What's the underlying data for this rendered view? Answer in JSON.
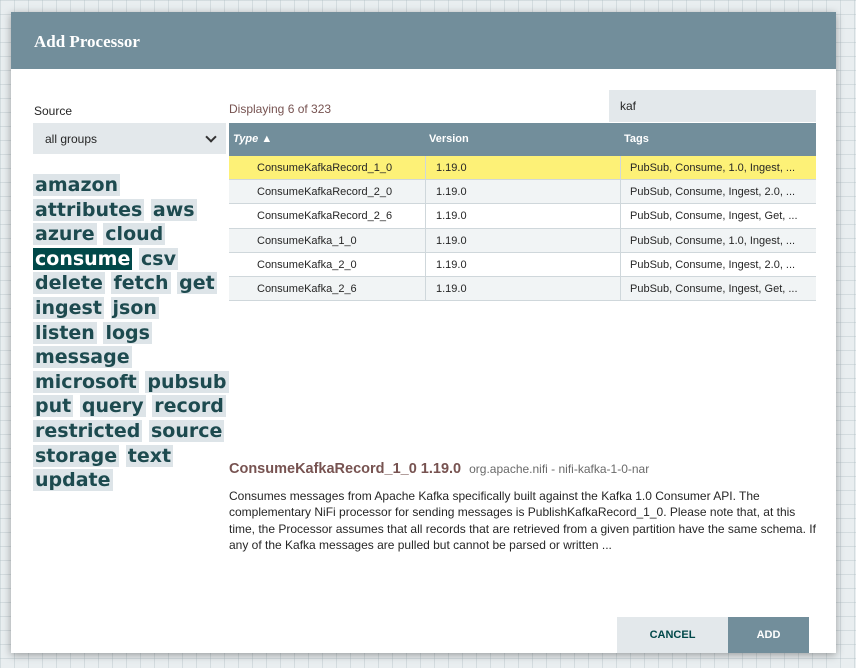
{
  "dialog": {
    "title": "Add Processor"
  },
  "source": {
    "label": "Source",
    "selected": "all groups"
  },
  "tags": [
    "amazon",
    "attributes",
    "aws",
    "azure",
    "cloud",
    "consume",
    "csv",
    "delete",
    "fetch",
    "get",
    "ingest",
    "json",
    "listen",
    "logs",
    "message",
    "microsoft",
    "pubsub",
    "put",
    "query",
    "record",
    "restricted",
    "source",
    "storage",
    "text",
    "update"
  ],
  "selected_tag": "consume",
  "table": {
    "displaying": "Displaying 6 of 323",
    "filter_value": "kaf",
    "headers": {
      "type": "Type ▲",
      "version": "Version",
      "tags": "Tags"
    },
    "rows": [
      {
        "type": "ConsumeKafkaRecord_1_0",
        "version": "1.19.0",
        "tags": "PubSub, Consume, 1.0, Ingest, ..."
      },
      {
        "type": "ConsumeKafkaRecord_2_0",
        "version": "1.19.0",
        "tags": "PubSub, Consume, Ingest, 2.0, ..."
      },
      {
        "type": "ConsumeKafkaRecord_2_6",
        "version": "1.19.0",
        "tags": "PubSub, Consume, Ingest, Get, ..."
      },
      {
        "type": "ConsumeKafka_1_0",
        "version": "1.19.0",
        "tags": "PubSub, Consume, 1.0, Ingest, ..."
      },
      {
        "type": "ConsumeKafka_2_0",
        "version": "1.19.0",
        "tags": "PubSub, Consume, Ingest, 2.0, ..."
      },
      {
        "type": "ConsumeKafka_2_6",
        "version": "1.19.0",
        "tags": "PubSub, Consume, Ingest, Get, ..."
      }
    ],
    "selected_index": 0
  },
  "details": {
    "name": "ConsumeKafkaRecord_1_0 1.19.0",
    "bundle": "org.apache.nifi - nifi-kafka-1-0-nar",
    "description": "Consumes messages from Apache Kafka specifically built against the Kafka 1.0 Consumer API. The complementary NiFi processor for sending messages is PublishKafkaRecord_1_0. Please note that, at this time, the Processor assumes that all records that are retrieved from a given partition have the same schema. If any of the Kafka messages are pulled but cannot be parsed or written ..."
  },
  "buttons": {
    "cancel": "CANCEL",
    "add": "ADD"
  },
  "colors": {
    "header": "#728e9b",
    "accent": "#004849",
    "selected_row": "#fdf177",
    "title_text": "#775351"
  }
}
